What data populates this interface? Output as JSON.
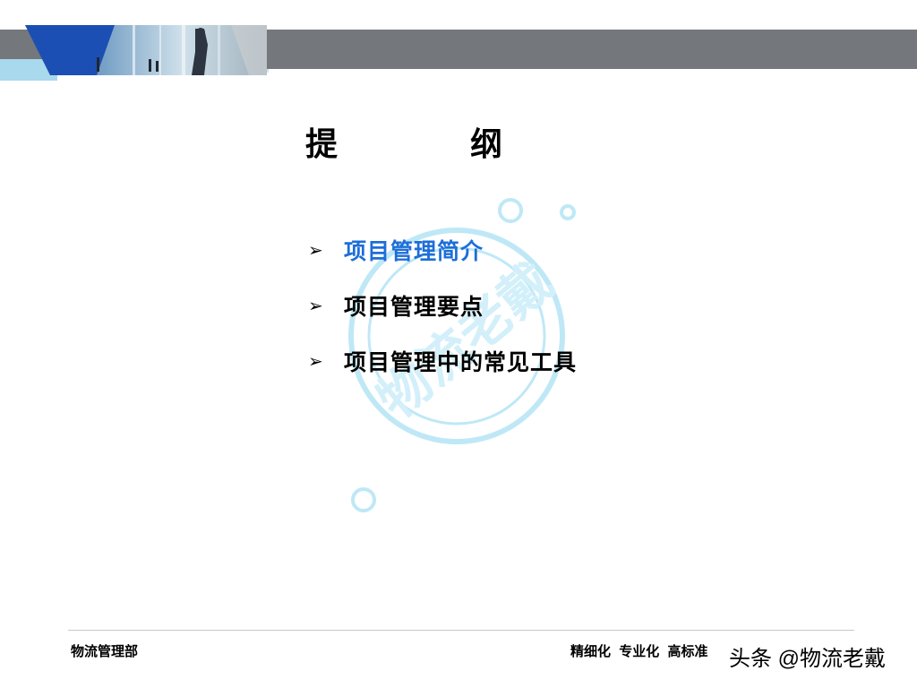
{
  "slide": {
    "title": "提　纲",
    "outline": [
      {
        "label": "项目管理简介",
        "active": true
      },
      {
        "label": "项目管理要点",
        "active": false
      },
      {
        "label": "项目管理中的常见工具",
        "active": false
      }
    ],
    "bullet_icon": "arrow-bullet-icon"
  },
  "footer": {
    "department": "物流管理部",
    "slogan": "精细化 专业化 高标准",
    "watermark_author": "头条 @物流老戴"
  },
  "watermark": {
    "text": "物流老戴"
  },
  "colors": {
    "active_item": "#1d6ed8",
    "banner_gray": "#74777b",
    "banner_blue": "#1b4fb3",
    "watermark_cyan": "#bfe8f6"
  }
}
